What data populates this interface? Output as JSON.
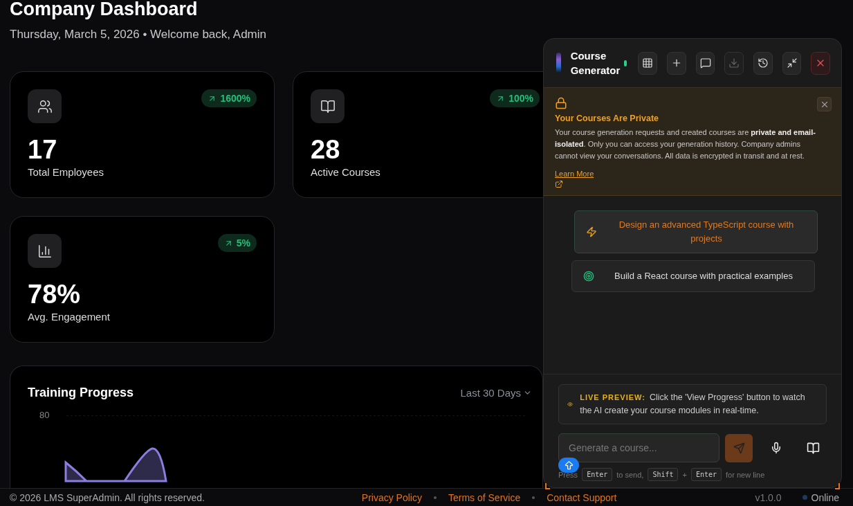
{
  "header": {
    "title": "Company Dashboard",
    "subtitle": "Thursday, March 5, 2026 • Welcome back, Admin"
  },
  "stats": [
    {
      "kind": "users",
      "value": "17",
      "label": "Total Employees",
      "change": "1600%"
    },
    {
      "kind": "courses",
      "value": "28",
      "label": "Active Courses",
      "change": "100%"
    },
    {
      "kind": "engagement",
      "value": "78%",
      "label": "Avg. Engagement",
      "change": "5%"
    }
  ],
  "training_progress": {
    "title": "Training Progress",
    "period": "Last 30 Days",
    "y_tick_labels": [
      "80"
    ]
  },
  "footer": {
    "copyright": "© 2026 LMS SuperAdmin. All rights reserved.",
    "links": [
      "Privacy Policy",
      "Terms of Service",
      "Contact Support"
    ],
    "version": "v1.0.0",
    "status": "Online"
  },
  "course_generator": {
    "title": "Course Generator",
    "online": true,
    "toolbar": [
      {
        "kind": "grid",
        "disabled": false
      },
      {
        "kind": "plus",
        "disabled": false
      },
      {
        "kind": "chat",
        "disabled": false
      },
      {
        "kind": "download",
        "disabled": true
      },
      {
        "kind": "history",
        "disabled": false
      },
      {
        "kind": "minimize",
        "disabled": false
      },
      {
        "kind": "close",
        "disabled": false
      }
    ],
    "privacy_notice": {
      "title": "Your Courses Are Private",
      "body": "Your course generation requests and created courses are **private and email-isolated**. Only you can access your generation history. Company admins cannot view your conversations. All data is encrypted in transit and at rest.",
      "link": "Learn More"
    },
    "suggestions": [
      {
        "kind": "bolt",
        "text": "Design an advanced TypeScript course with projects",
        "selected": true
      },
      {
        "kind": "target",
        "text": "Build a React course with practical examples",
        "selected": false
      }
    ],
    "live_preview": {
      "label": "LIVE PREVIEW:",
      "text": "Click the 'View Progress' button to watch the AI create your course modules in real-time."
    },
    "input": {
      "placeholder": "Generate a course..."
    },
    "hint": [
      {
        "kind": "text",
        "text": "Press"
      },
      {
        "kind": "key",
        "text": "Enter"
      },
      {
        "kind": "text",
        "text": "to send,"
      },
      {
        "kind": "key",
        "text": "Shift"
      },
      {
        "kind": "text",
        "text": "+"
      },
      {
        "kind": "key",
        "text": "Enter"
      },
      {
        "kind": "text",
        "text": "for new line"
      }
    ]
  }
}
